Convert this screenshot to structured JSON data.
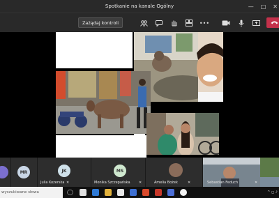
{
  "window": {
    "title": "Spotkanie na kanale Ogólny",
    "minimize": "—",
    "maximize": "□",
    "close": "✕"
  },
  "toolbar": {
    "request_control_label": "Zażądaj kontroli",
    "icons": [
      "people-icon",
      "chat-icon",
      "raise-hand-icon",
      "breakout-icon",
      "more-icon",
      "camera-icon",
      "mic-icon",
      "share-icon",
      "leave-icon"
    ]
  },
  "participants": [
    {
      "initials": "",
      "name": "",
      "color": "#7b6fd0"
    },
    {
      "initials": "MR",
      "name": "",
      "color": "#c9d6e6"
    },
    {
      "initials": "JK",
      "name": "Julia Kozerska",
      "color": "#cfe1ea"
    },
    {
      "initials": "MS",
      "name": "Monika Szczepańska",
      "color": "#cfe8cf"
    },
    {
      "initials": "",
      "name": "Amelia Bożek",
      "color": "#8a6c5a"
    },
    {
      "initials": "",
      "name": "Sebastian Feduch",
      "color": "#555"
    }
  ],
  "taskbar": {
    "search_placeholder": "wyszukiwane słowa",
    "tray_text": "^ ◻ ♪"
  },
  "colors": {
    "leave": "#c4314b",
    "toolbar": "#292929",
    "stage": "#000000"
  }
}
